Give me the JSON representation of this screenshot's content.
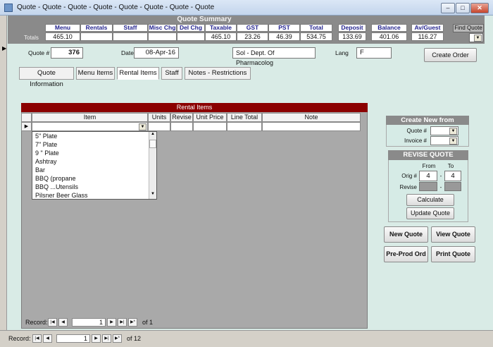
{
  "window": {
    "title": "Quote - Quote - Quote - Quote - Quote - Quote - Quote - Quote",
    "minimize": "–",
    "maximize": "□",
    "close": "✕"
  },
  "summary": {
    "title": "Quote Summary",
    "totals_label": "Totals",
    "columns": [
      {
        "label": "Menu",
        "value": "465.10"
      },
      {
        "label": "Rentals",
        "value": ""
      },
      {
        "label": "Staff",
        "value": ""
      },
      {
        "label": "Misc Chg",
        "value": ""
      },
      {
        "label": "Del Chg",
        "value": ""
      },
      {
        "label": "Taxable",
        "value": "465.10"
      },
      {
        "label": "GST",
        "value": "23.26"
      },
      {
        "label": "PST",
        "value": "46.39"
      },
      {
        "label": "Total",
        "value": "534.75"
      },
      {
        "label": "Deposit",
        "value": "133.69"
      },
      {
        "label": "Balance",
        "value": "401.06"
      },
      {
        "label": "Av/Guest",
        "value": "116.27"
      }
    ],
    "find_quote_label": "Find Quote"
  },
  "header": {
    "quote_label": "Quote #",
    "quote_value": "376",
    "date_label": "Date",
    "date_value": "08-Apr-16",
    "client_value": "Sol - Dept. Of Pharmacolog",
    "lang_label": "Lang",
    "lang_value": "F",
    "create_order": "Create Order"
  },
  "tabs": [
    {
      "label": "Quote Information"
    },
    {
      "label": "Menu Items"
    },
    {
      "label": "Rental Items"
    },
    {
      "label": "Staff"
    },
    {
      "label": "Notes - Restrictions"
    }
  ],
  "rental": {
    "title": "Rental Items",
    "columns": [
      "Item",
      "Units",
      "Revise",
      "Unit Price",
      "Line Total",
      "Note"
    ],
    "dropdown_items": [
      "5\" Plate",
      "7\" Plate",
      "9 \" Plate",
      "Ashtray",
      "Bar",
      "BBQ (propane",
      "BBQ ...Utensils",
      "Pilsner Beer Glass"
    ],
    "nav": {
      "label": "Record:",
      "current": "1",
      "of": "of 1"
    }
  },
  "create_new": {
    "title": "Create New from",
    "quote_label": "Quote #",
    "invoice_label": "Invoice #"
  },
  "revise": {
    "title": "REVISE QUOTE",
    "from_label": "From",
    "to_label": "To",
    "orig_label": "Orig #",
    "orig_from": "4",
    "orig_to": "4",
    "revise_label": "Revise",
    "dash": "-",
    "calculate": "Calculate",
    "update": "Update Quote"
  },
  "actions": {
    "new_quote": "New Quote",
    "view_quote": "View Quote",
    "preprod": "Pre-Prod Ord",
    "print_quote": "Print Quote"
  },
  "status": {
    "label": "Record:",
    "current": "1",
    "of": "of 12"
  }
}
